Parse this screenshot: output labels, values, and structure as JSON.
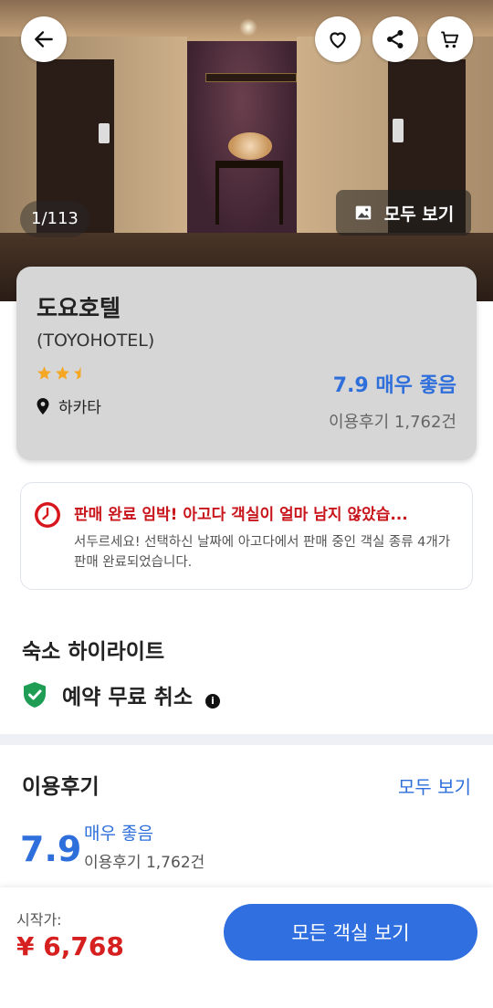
{
  "hero": {
    "photo_counter": "1/113",
    "view_all_photos_label": "모두 보기"
  },
  "header_actions": {
    "back": "arrow-left-icon",
    "favorite": "heart-icon",
    "share": "share-icon",
    "cart": "cart-icon"
  },
  "hotel": {
    "name": "도요호텔",
    "name_en": "(TOYOHOTEL)",
    "star_rating": 2.5,
    "location": "하카타",
    "score_text": "7.9 매우 좋음",
    "review_count": "이용후기 1,762건"
  },
  "urgency": {
    "title": "판매 완료 임박! 아고다 객실이 얼마 남지 않았습...",
    "description": "서두르세요! 선택하신 날짜에 아고다에서 판매 중인 객실 종류 4개가 판매 완료되었습니다."
  },
  "highlights": {
    "title": "숙소 하이라이트",
    "items": [
      {
        "label": "예약 무료 취소",
        "icon": "shield-check-icon"
      }
    ]
  },
  "reviews": {
    "title": "이용후기",
    "view_all": "모두 보기",
    "score": "7.9",
    "label": "매우 좋음",
    "count": "이용후기 1,762건"
  },
  "bottom": {
    "from_label": "시작가:",
    "price": "¥ 6,768",
    "cta": "모든 객실 보기"
  },
  "colors": {
    "accent_blue": "#2e6fdb",
    "price_red": "#d61f1f",
    "urgency_red": "#c8141b",
    "star_orange": "#f5a623",
    "shield_green": "#1f9d55"
  }
}
